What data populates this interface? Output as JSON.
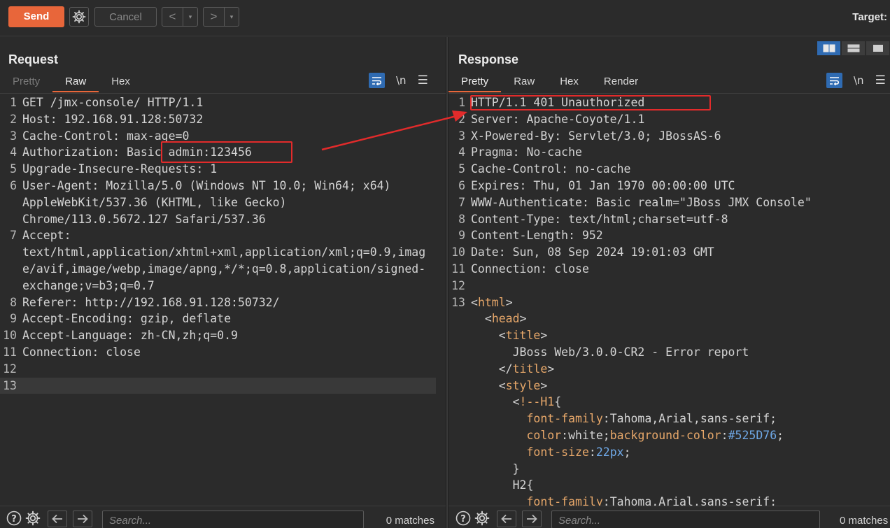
{
  "toolbar": {
    "send_label": "Send",
    "cancel_label": "Cancel",
    "back_label": "<",
    "forward_label": ">",
    "dropdown_glyph": "▾",
    "target_label": "Target:"
  },
  "request": {
    "title": "Request",
    "tabs": [
      "Pretty",
      "Raw",
      "Hex"
    ],
    "active_tab": "Raw",
    "newline_toggle": "\\n",
    "lines": [
      {
        "n": "1",
        "text": "GET /jmx-console/ HTTP/1.1"
      },
      {
        "n": "2",
        "text": "Host: 192.168.91.128:50732"
      },
      {
        "n": "3",
        "text": "Cache-Control: max-age=0"
      },
      {
        "n": "4",
        "text": "Authorization: Basic admin:123456"
      },
      {
        "n": "5",
        "text": "Upgrade-Insecure-Requests: 1"
      },
      {
        "n": "6",
        "text": "User-Agent: Mozilla/5.0 (Windows NT 10.0; Win64; x64)"
      },
      {
        "n": "",
        "text": "AppleWebKit/537.36 (KHTML, like Gecko)"
      },
      {
        "n": "",
        "text": "Chrome/113.0.5672.127 Safari/537.36"
      },
      {
        "n": "7",
        "text": "Accept:"
      },
      {
        "n": "",
        "text": "text/html,application/xhtml+xml,application/xml;q=0.9,imag"
      },
      {
        "n": "",
        "text": "e/avif,image/webp,image/apng,*/*;q=0.8,application/signed-"
      },
      {
        "n": "",
        "text": "exchange;v=b3;q=0.7"
      },
      {
        "n": "8",
        "text": "Referer: http://192.168.91.128:50732/"
      },
      {
        "n": "9",
        "text": "Accept-Encoding: gzip, deflate"
      },
      {
        "n": "10",
        "text": "Accept-Language: zh-CN,zh;q=0.9"
      },
      {
        "n": "11",
        "text": "Connection: close"
      },
      {
        "n": "12",
        "text": ""
      },
      {
        "n": "13",
        "text": ""
      }
    ],
    "search_placeholder": "Search...",
    "matches": "0 matches"
  },
  "response": {
    "title": "Response",
    "tabs": [
      "Pretty",
      "Raw",
      "Hex",
      "Render"
    ],
    "active_tab": "Pretty",
    "newline_toggle": "\\n",
    "lines": [
      {
        "n": "1",
        "text": "HTTP/1.1 401 Unauthorized"
      },
      {
        "n": "2",
        "text": "Server: Apache-Coyote/1.1"
      },
      {
        "n": "3",
        "text": "X-Powered-By: Servlet/3.0; JBossAS-6"
      },
      {
        "n": "4",
        "text": "Pragma: No-cache"
      },
      {
        "n": "5",
        "text": "Cache-Control: no-cache"
      },
      {
        "n": "6",
        "text": "Expires: Thu, 01 Jan 1970 00:00:00 UTC"
      },
      {
        "n": "7",
        "text": "WWW-Authenticate: Basic realm=\"JBoss JMX Console\""
      },
      {
        "n": "8",
        "text": "Content-Type: text/html;charset=utf-8"
      },
      {
        "n": "9",
        "text": "Content-Length: 952"
      },
      {
        "n": "10",
        "text": "Date: Sun, 08 Sep 2024 19:01:03 GMT"
      },
      {
        "n": "11",
        "text": "Connection: close"
      },
      {
        "n": "12",
        "text": ""
      },
      {
        "n": "13",
        "text": "<html>"
      },
      {
        "n": "",
        "text": "  <head>"
      },
      {
        "n": "",
        "text": "    <title>"
      },
      {
        "n": "",
        "text": "      JBoss Web/3.0.0-CR2 - Error report"
      },
      {
        "n": "",
        "text": "    </title>"
      },
      {
        "n": "",
        "text": "    <style>"
      },
      {
        "n": "",
        "text": "      <!--H1{"
      },
      {
        "n": "",
        "text": "        font-family:Tahoma,Arial,sans-serif;"
      },
      {
        "n": "",
        "text": "        color:white;background-color:#525D76;"
      },
      {
        "n": "",
        "text": "        font-size:22px;"
      },
      {
        "n": "",
        "text": "      }"
      },
      {
        "n": "",
        "text": "      H2{"
      },
      {
        "n": "",
        "text": "        font-family:Tahoma,Arial,sans-serif;"
      }
    ],
    "search_placeholder": "Search...",
    "matches": "0 matches"
  },
  "colors": {
    "accent": "#e8663a",
    "annotation": "#e22b2b",
    "selected_blue": "#2f6bb2"
  }
}
